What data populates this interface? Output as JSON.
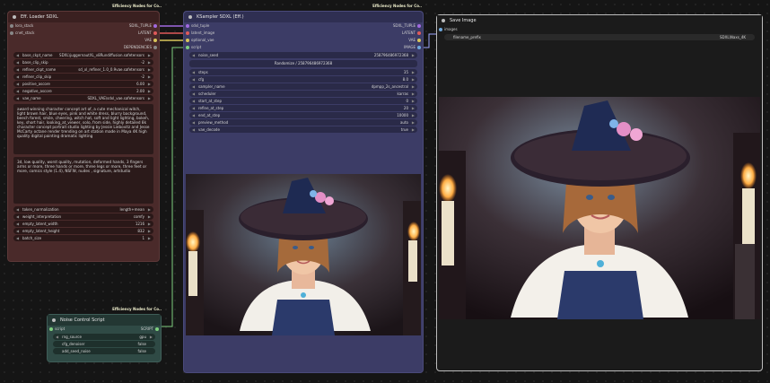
{
  "colors": {
    "loader_bg": "#4a2a2a",
    "ksampler_bg": "#3c3c66",
    "noise_bg": "#2f4a45",
    "save_border": "#bcbcbc",
    "link_yellow": "#d9c65b",
    "link_purple": "#a16ae0",
    "link_red": "#e05a5a",
    "link_green": "#7fcf7f"
  },
  "loader": {
    "badge": "Efficiency Nodes for Co..",
    "title": "Eff. Loader SDXL",
    "inputs": [
      "lora_stack",
      "cnet_stack"
    ],
    "outputs": [
      "SDXL_TUPLE",
      "LATENT",
      "VAE",
      "DEPENDENCIES"
    ],
    "widgets": [
      {
        "label": "base_ckpt_name",
        "value": "SDXL\\juggernautXL_v8Rundiffusion.safetensors"
      },
      {
        "label": "base_clip_skip",
        "value": "-2"
      },
      {
        "label": "refiner_ckpt_name",
        "value": "sd_xl_refiner_1.0_0.9vae.safetensors"
      },
      {
        "label": "refiner_clip_skip",
        "value": "-2"
      },
      {
        "label": "positive_ascore",
        "value": "6.00"
      },
      {
        "label": "negative_ascore",
        "value": "2.00"
      },
      {
        "label": "vae_name",
        "value": "SDXL_VAE\\sdxl_vae.safetensors"
      }
    ],
    "positive": "award winning character concept art of, a cute mechanical witch, light brown hair, blue eyes, pink and white dress, blurry background, beech forest, smile, cheering, witch hat, soft and light lighting, bokeh, key, short hair, looking_at_viewer, solo, from side, highly detailed 8k character concept portrait studio lighting by Jessie Liebovitz and Jesse McCarty octane render trending on art station made in Maya 4K high quality digital painting dramatic lighting",
    "negative": "3d, low quality, worst quality, mutation, deformed hands, 3 fingers arms or more, three hands or more, three legs or more, three feet or more, comics style (1.4), NSFW, nudes , signature, artstudio",
    "widgets2": [
      {
        "label": "token_normalization",
        "value": "length+mean"
      },
      {
        "label": "weight_interpretation",
        "value": "comfy"
      },
      {
        "label": "empty_latent_width",
        "value": "1216"
      },
      {
        "label": "empty_latent_height",
        "value": "832"
      },
      {
        "label": "batch_size",
        "value": "1"
      }
    ]
  },
  "ksampler": {
    "badge": "Efficiency Nodes for Co..",
    "title": "KSampler SDXL (Eff.)",
    "inputs": [
      "sdxl_tuple",
      "latent_image",
      "optional_vae",
      "script"
    ],
    "outputs": [
      "SDXL_TUPLE",
      "LATENT",
      "VAE",
      "IMAGE"
    ],
    "seed_widget": {
      "label": "noise_seed",
      "value": "258796486972368"
    },
    "seed_button": "Randomize / 258796486972368",
    "widgets": [
      {
        "label": "steps",
        "value": "35"
      },
      {
        "label": "cfg",
        "value": "8.0"
      },
      {
        "label": "sampler_name",
        "value": "dpmpp_2s_ancestral"
      },
      {
        "label": "scheduler",
        "value": "karras"
      },
      {
        "label": "start_at_step",
        "value": "0"
      },
      {
        "label": "refine_at_step",
        "value": "20"
      },
      {
        "label": "end_at_step",
        "value": "10000"
      },
      {
        "label": "preview_method",
        "value": "auto"
      },
      {
        "label": "vae_decode",
        "value": "true"
      }
    ]
  },
  "noise": {
    "badge": "Efficiency Nodes for Co..",
    "title": "Noise Control Script",
    "inputs": [
      "script"
    ],
    "outputs": [
      "SCRIPT"
    ],
    "widgets": [
      {
        "label": "rng_source",
        "value": "gpu"
      },
      {
        "label": "cfg_denoiser",
        "value": "false"
      },
      {
        "label": "add_seed_noise",
        "value": "false"
      }
    ]
  },
  "save": {
    "title": "Save Image",
    "inputs": [
      "images"
    ],
    "widget": {
      "label": "filename_prefix",
      "value": "SDXL\\Naxs_4K"
    }
  }
}
